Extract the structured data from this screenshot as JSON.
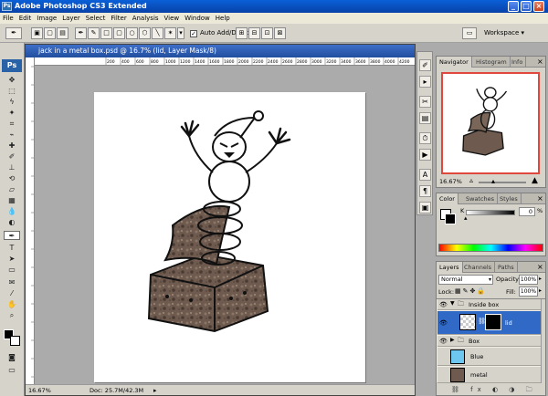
{
  "app": {
    "title": "Adobe Photoshop CS3 Extended",
    "logo": "Ps",
    "mini_logo": "Ps"
  },
  "window_controls": {
    "minimize": "_",
    "maximize": "□",
    "close": "×"
  },
  "menu": [
    "File",
    "Edit",
    "Image",
    "Layer",
    "Select",
    "Filter",
    "Analysis",
    "View",
    "Window",
    "Help"
  ],
  "options_bar": {
    "auto_add_delete": "Auto Add/Delete",
    "workspace": "Workspace ▾"
  },
  "document": {
    "title": "jack in a metal box.psd @ 16.7% (lid, Layer Mask/8)",
    "zoom": "16.67%",
    "doc_info": "Doc: 25.7M/42.3M",
    "ruler_labels": [
      "200",
      "400",
      "600",
      "800",
      "1000",
      "1200",
      "1400",
      "1600",
      "1800",
      "2000",
      "2200",
      "2400",
      "2600",
      "2800",
      "3000",
      "3200",
      "3400",
      "3600",
      "3800",
      "4000",
      "4200"
    ]
  },
  "navigator": {
    "tabs": [
      "Navigator",
      "Histogram",
      "Info"
    ],
    "zoom": "16.67%",
    "close": "×"
  },
  "color_panel": {
    "tabs": [
      "Color",
      "Swatches",
      "Styles"
    ],
    "channel": "K",
    "value": "0",
    "unit": "%",
    "close": "×"
  },
  "layers_panel": {
    "tabs": [
      "Layers",
      "Channels",
      "Paths"
    ],
    "close": "×",
    "blend_mode": "Normal",
    "opacity_label": "Opacity:",
    "opacity": "100%",
    "lock_label": "Lock:",
    "fill_label": "Fill:",
    "fill": "100%",
    "layers": [
      {
        "name": "Inside box",
        "kind": "group"
      },
      {
        "name": "lid",
        "kind": "masked",
        "selected": true
      },
      {
        "name": "Box",
        "kind": "group"
      },
      {
        "name": "Blue",
        "kind": "layer",
        "color": "#6ec7f0"
      },
      {
        "name": "metal",
        "kind": "layer"
      }
    ]
  },
  "colors": {
    "accent": "#0a5fd8",
    "selection": "#3169c6",
    "layer_blue": "#6ec7f0"
  }
}
